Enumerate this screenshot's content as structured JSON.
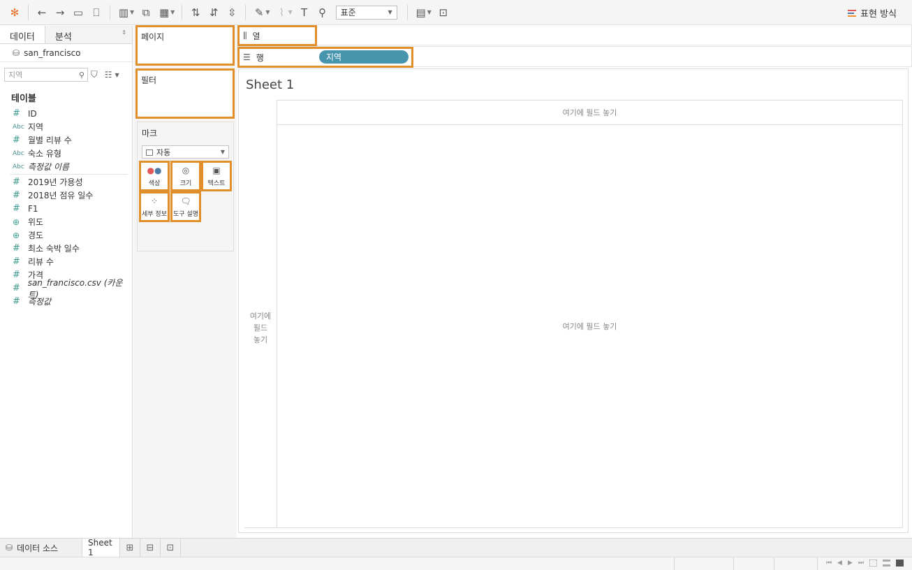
{
  "toolbar": {
    "fit_select": "표준",
    "show_me": "표현 방식",
    "colors": {
      "showme_1": "#e15759",
      "showme_2": "#4e79a7",
      "showme_3": "#f28e2b"
    }
  },
  "data_pane": {
    "tabs": [
      "데이터",
      "분석"
    ],
    "datasource": "san_francisco",
    "search_placeholder": "지역",
    "section_title": "테이블",
    "dimensions": [
      {
        "type": "num",
        "label": "ID"
      },
      {
        "type": "abc",
        "label": "지역"
      },
      {
        "type": "num",
        "label": "월별 리뷰 수"
      },
      {
        "type": "abc",
        "label": "숙소 유형"
      },
      {
        "type": "abc",
        "label": "측정값 이름"
      }
    ],
    "measures": [
      {
        "type": "num",
        "label": "2019년 가용성"
      },
      {
        "type": "num",
        "label": "2018년 점유 일수"
      },
      {
        "type": "num",
        "label": "F1"
      },
      {
        "type": "globe",
        "label": "위도"
      },
      {
        "type": "globe",
        "label": "경도"
      },
      {
        "type": "num",
        "label": "최소 숙박 일수"
      },
      {
        "type": "num",
        "label": "리뷰 수"
      },
      {
        "type": "num",
        "label": "가격"
      },
      {
        "type": "num",
        "label": "san_francisco.csv (카운트)"
      },
      {
        "type": "num",
        "label": "측정값"
      }
    ],
    "abc_label": "Abc",
    "num_glyph": "#"
  },
  "shelves": {
    "pages": "페이지",
    "filters": "필터",
    "marks": {
      "title": "마크",
      "type": "자동",
      "buttons": [
        "색상",
        "크기",
        "텍스트",
        "세부 정보",
        "도구 설명"
      ]
    },
    "columns": "열",
    "rows": "행",
    "rows_pill": "지역"
  },
  "canvas": {
    "sheet_title": "Sheet 1",
    "drop_top": "여기에 필드 놓기",
    "drop_left": [
      "여기에",
      "필드",
      "놓기"
    ],
    "drop_center": "여기에 필드 놓기"
  },
  "bottom_tabs": {
    "datasource": "데이터 소스",
    "sheet": "Sheet 1"
  },
  "accent": {
    "highlight": "#e08f2a",
    "pill": "#4795ad"
  }
}
